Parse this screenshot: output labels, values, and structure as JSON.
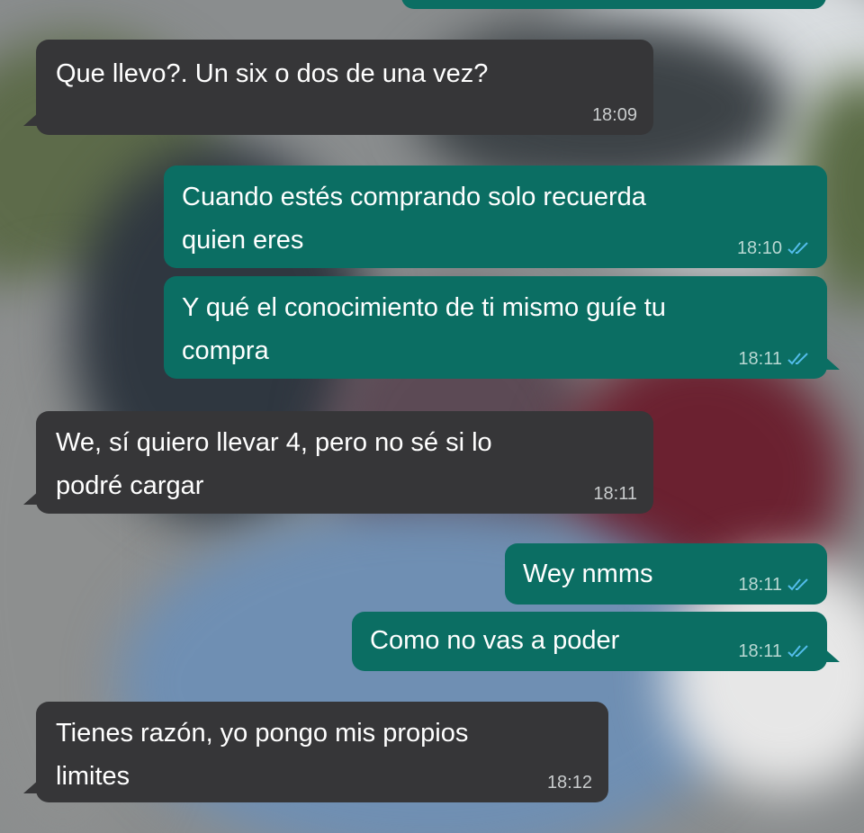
{
  "conversation": {
    "messages": [
      {
        "direction": "incoming",
        "text": "Que llevo?. Un six o dos de una vez?",
        "time": "18:09"
      },
      {
        "direction": "outgoing",
        "text": "Cuando estés comprando solo recuerda\nquien eres",
        "time": "18:10",
        "status": "read-double-check-icon"
      },
      {
        "direction": "outgoing",
        "text": "Y qué el conocimiento de ti mismo guíe tu\ncompra",
        "time": "18:11",
        "status": "read-double-check-icon"
      },
      {
        "direction": "incoming",
        "text": "We, sí quiero llevar 4, pero no sé si lo\npodré cargar",
        "time": "18:11"
      },
      {
        "direction": "outgoing",
        "text": "Wey nmms",
        "time": "18:11",
        "status": "read-double-check-icon"
      },
      {
        "direction": "outgoing",
        "text": "Como no vas a poder",
        "time": "18:11",
        "status": "read-double-check-icon"
      },
      {
        "direction": "incoming",
        "text": "Tienes razón, yo pongo mis propios\nlimites",
        "time": "18:12"
      }
    ]
  },
  "colors": {
    "incoming_bubble": "#363638",
    "outgoing_bubble": "#0b6e63",
    "read_tick": "#53bdeb",
    "text": "#ffffff"
  }
}
